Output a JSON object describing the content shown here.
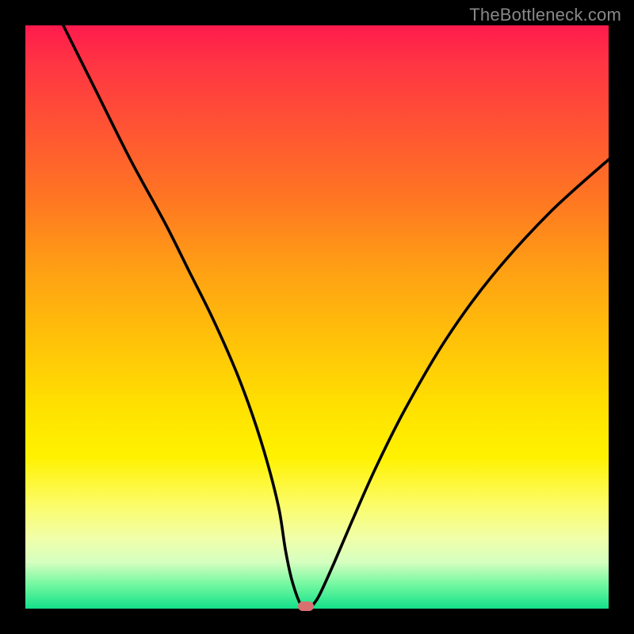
{
  "watermark": "TheBottleneck.com",
  "colors": {
    "curve_stroke": "#000000",
    "dot_fill": "#d87070",
    "frame_bg": "#000000"
  },
  "layout": {
    "canvas_size": 800,
    "plot_inset": 32,
    "plot_size": 736
  },
  "chart_data": {
    "type": "line",
    "title": "",
    "xlabel": "",
    "ylabel": "",
    "xlim": [
      0,
      100
    ],
    "ylim": [
      0,
      100
    ],
    "grid": false,
    "note": "Axes are unlabeled; x and y are normalized 0–100 to plot extents (0,0 = bottom-left). Values estimated from pixel positions.",
    "series": [
      {
        "name": "bottleneck-curve",
        "x": [
          6.5,
          12,
          18,
          24,
          28,
          32,
          36,
          39,
          41.5,
          43.5,
          44.6,
          45.8,
          47.4,
          48.9,
          49.5,
          50.5,
          53,
          56,
          60,
          65,
          72,
          80,
          90,
          100
        ],
        "y": [
          100,
          89,
          77,
          66,
          58,
          50,
          41,
          33,
          25,
          17,
          10,
          4.5,
          0.4,
          0.4,
          0.9,
          2.5,
          8,
          15,
          24,
          34,
          46,
          57,
          68,
          77
        ]
      }
    ],
    "marker": {
      "name": "minimum-point",
      "x": 48.1,
      "y": 0.4
    },
    "gradient_stops": [
      {
        "pos": 0,
        "color": "#ff1a4d"
      },
      {
        "pos": 6,
        "color": "#ff3344"
      },
      {
        "pos": 18,
        "color": "#ff5533"
      },
      {
        "pos": 30,
        "color": "#ff7722"
      },
      {
        "pos": 42,
        "color": "#ffa014"
      },
      {
        "pos": 54,
        "color": "#ffc209"
      },
      {
        "pos": 66,
        "color": "#ffe200"
      },
      {
        "pos": 74,
        "color": "#fff200"
      },
      {
        "pos": 82,
        "color": "#fcfc66"
      },
      {
        "pos": 88,
        "color": "#f0ffaa"
      },
      {
        "pos": 92,
        "color": "#d6ffc0"
      },
      {
        "pos": 96,
        "color": "#70f7a0"
      },
      {
        "pos": 100,
        "color": "#14e08a"
      }
    ]
  }
}
